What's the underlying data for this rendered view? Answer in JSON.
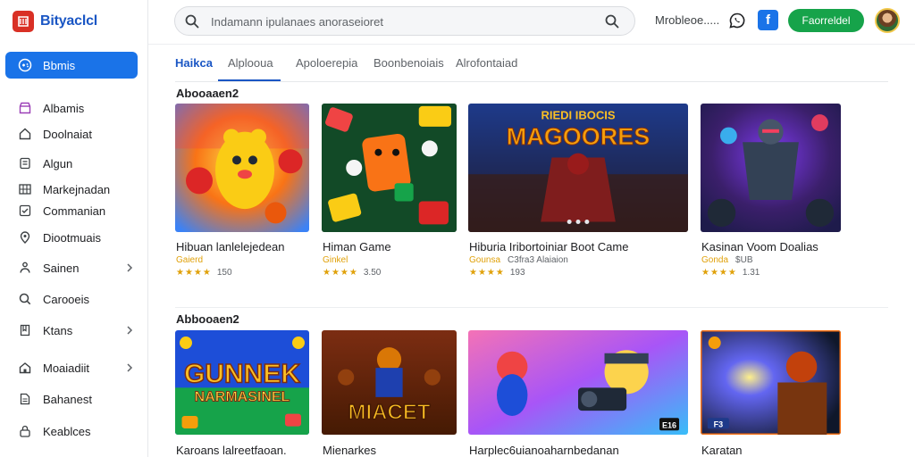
{
  "brand": {
    "name": "Bityaclcl"
  },
  "sidebar": {
    "items": [
      {
        "label": "Bbmis",
        "icon": "gamepad-icon",
        "active": true,
        "chevron": false
      },
      {
        "label": "Albamis",
        "icon": "store-icon",
        "active": false,
        "chevron": false
      },
      {
        "label": "Doolnaiat",
        "icon": "home-icon",
        "active": false,
        "chevron": false
      },
      {
        "label": "Algun",
        "icon": "tag-icon",
        "active": false,
        "chevron": false
      },
      {
        "label": "Markejnadan",
        "icon": "grid-icon",
        "active": false,
        "chevron": false
      },
      {
        "label": "Commanian",
        "icon": "checkbox-icon",
        "active": false,
        "chevron": false
      },
      {
        "label": "Diootmuais",
        "icon": "location-icon",
        "active": false,
        "chevron": false
      },
      {
        "label": "Sainen",
        "icon": "share-icon",
        "active": false,
        "chevron": true
      },
      {
        "label": "Carooeis",
        "icon": "search-icon",
        "active": false,
        "chevron": false
      },
      {
        "label": "Ktans",
        "icon": "bookmark-icon",
        "active": false,
        "chevron": true
      },
      {
        "label": "Moaiadiit",
        "icon": "house-icon",
        "active": false,
        "chevron": true
      },
      {
        "label": "Bahanest",
        "icon": "document-icon",
        "active": false,
        "chevron": false
      },
      {
        "label": "Keablces",
        "icon": "lock-icon",
        "active": false,
        "chevron": false
      }
    ]
  },
  "search": {
    "placeholder": "Indamann ipulanaes anoraseioret"
  },
  "topbar": {
    "link": "Mrobleoe.....",
    "cta": "Faorreldel",
    "fb_letter": "f"
  },
  "tabs": [
    {
      "label": "Haikca",
      "active": true
    },
    {
      "label": "Alplooua",
      "active": false
    },
    {
      "label": "Apoloerepia",
      "active": false
    },
    {
      "label": "Boonbenoiais",
      "active": false
    },
    {
      "label": "Alrofontaiad",
      "active": false
    }
  ],
  "sections": [
    {
      "title": "Abooaaen2",
      "cards": [
        {
          "title": "Hibuan lanlelejedean",
          "meta": "Gaierd",
          "meta_extra": "",
          "stars": "★★★★",
          "score": "150",
          "art": "bear"
        },
        {
          "title": "Himan Game",
          "meta": "Ginkel",
          "meta_extra": "",
          "stars": "★★★★",
          "score": "3.50",
          "art": "dice"
        },
        {
          "title": "Hiburia Iribortoiniar Boot Came",
          "meta": "Gounsa",
          "meta_extra": "C3fra3 Alaiaion",
          "stars": "★★★★",
          "score": "193",
          "art": "magores",
          "art_text": [
            "RIEDI IBOCIS",
            "MAGOORES"
          ]
        },
        {
          "title": "Kasinan Voom Doalias",
          "meta": "Gonda",
          "meta_extra": "$UB",
          "stars": "★★★★",
          "score": "1.31",
          "art": "ninja"
        }
      ]
    },
    {
      "title": "Abbooaen2",
      "cards": [
        {
          "title": "Karoans lalreetfaoan.",
          "art": "gunner",
          "art_text": [
            "GUNNEK",
            "NARMASINEL"
          ]
        },
        {
          "title": "Mienarkes",
          "art": "maces",
          "art_text": [
            "MIACET"
          ]
        },
        {
          "title": "Harplec6uianoaharnbedanan",
          "art": "camera",
          "art_text": [
            "E16"
          ]
        },
        {
          "title": "Karatan",
          "art": "space",
          "art_text": [
            "F3"
          ]
        }
      ]
    }
  ],
  "colors": {
    "accent": "#1a73e8",
    "cta_green": "#16a34a",
    "brand_red": "#d93025",
    "star": "#e0a10a"
  }
}
